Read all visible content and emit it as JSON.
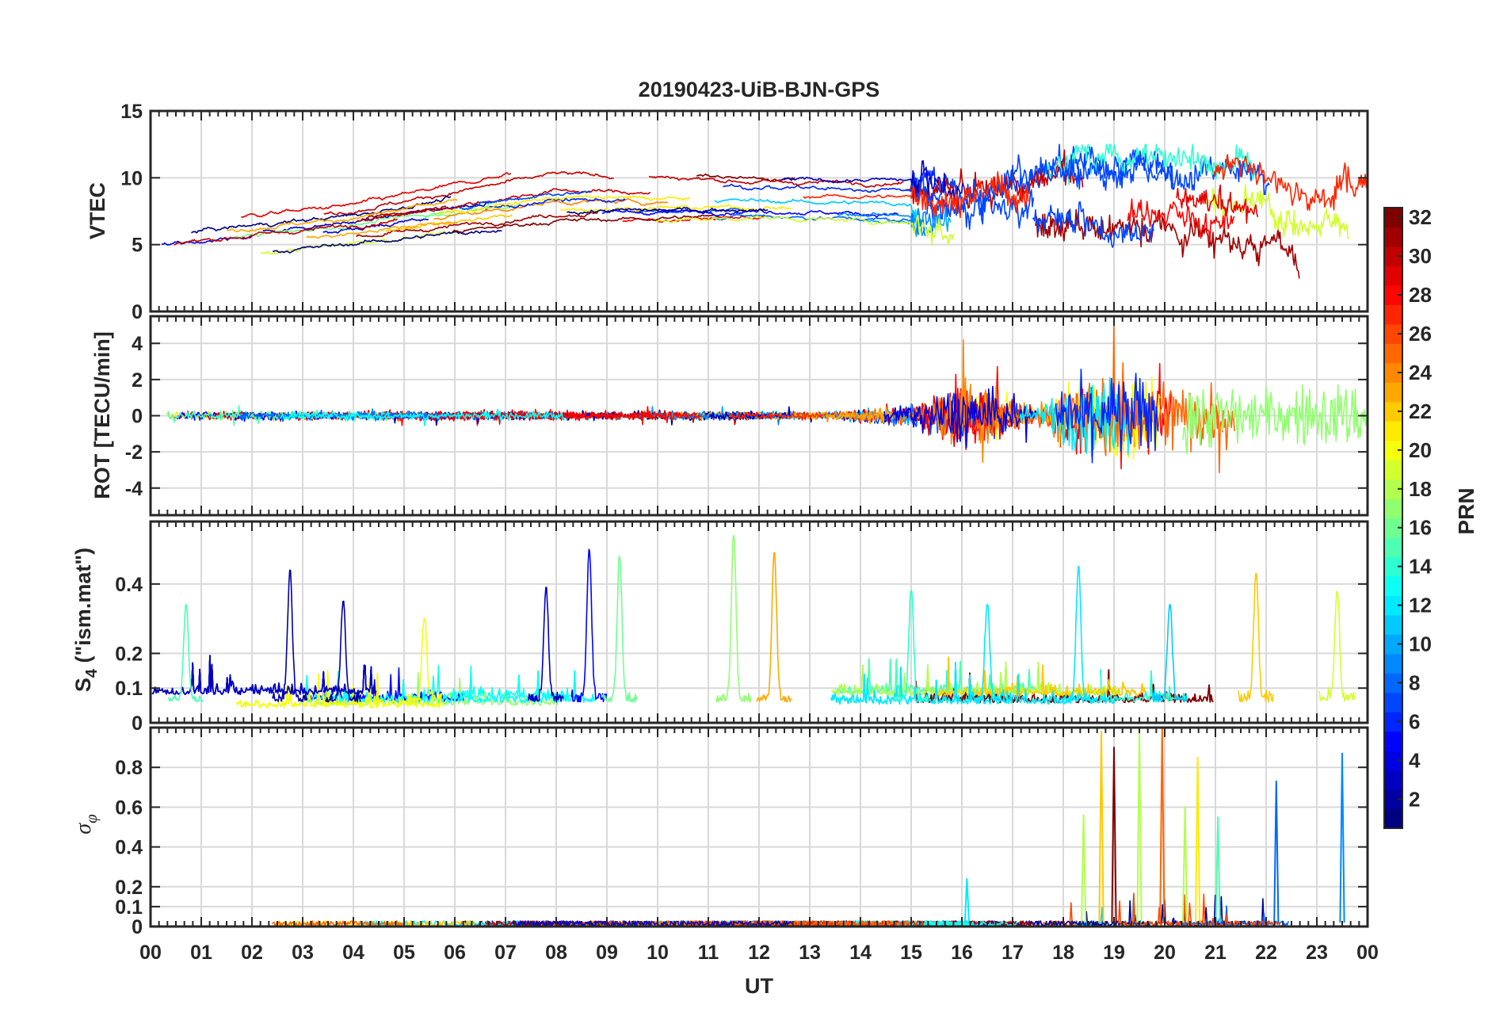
{
  "figure": {
    "title": "20190423-UiB-BJN-GPS"
  },
  "chart_data": {
    "type": "line",
    "title": "20190423-UiB-BJN-GPS",
    "shared_x": {
      "label": "UT",
      "range": [
        0,
        24
      ],
      "tick_labels": [
        "00",
        "01",
        "02",
        "03",
        "04",
        "05",
        "06",
        "07",
        "08",
        "09",
        "10",
        "11",
        "12",
        "13",
        "14",
        "15",
        "16",
        "17",
        "18",
        "19",
        "20",
        "21",
        "22",
        "23",
        "00"
      ],
      "grid": true
    },
    "color_scale": {
      "label": "PRN",
      "range": [
        1,
        32
      ],
      "colormap": "jet",
      "tick_labels": [
        "2",
        "4",
        "6",
        "8",
        "10",
        "12",
        "14",
        "16",
        "18",
        "20",
        "22",
        "24",
        "26",
        "28",
        "30",
        "32"
      ]
    },
    "note_series": "Each panel shows one line per GPS satellite (PRN 1-32), colored by PRN on the jet color scale; values are approximate envelope readings from the plot.",
    "panels": [
      {
        "key": "vtec",
        "ylabel": "VTEC",
        "ylim": [
          0,
          15
        ],
        "yticks": [
          0,
          5,
          10,
          15
        ],
        "ytick_labels": [
          "0",
          "5",
          "10",
          "15"
        ],
        "grid": true,
        "typical_range": {
          "x": [
            0,
            4,
            8,
            12,
            16,
            18,
            20,
            22,
            23,
            24
          ],
          "low": [
            3.5,
            5,
            6.5,
            7,
            6.5,
            6.5,
            6,
            5,
            3,
            5
          ],
          "high": [
            6.5,
            8,
            11,
            10,
            10,
            12,
            12.5,
            11.5,
            10,
            11
          ]
        },
        "peak_value": 12.5
      },
      {
        "key": "rot",
        "ylabel": "ROT [TECU/min]",
        "ylim": [
          -5.5,
          5.5
        ],
        "yticks": [
          -4,
          -2,
          0,
          2,
          4
        ],
        "ytick_labels": [
          "-4",
          "-2",
          "0",
          "2",
          "4"
        ],
        "grid": true,
        "typical_amplitude": {
          "x": [
            0,
            13.5,
            15,
            16,
            17.5,
            18,
            19,
            20,
            21,
            22,
            23,
            24
          ],
          "amp": [
            0.6,
            0.5,
            1.5,
            4.5,
            1.0,
            4.5,
            5.5,
            5.5,
            4.5,
            3.5,
            4.5,
            4.5
          ]
        }
      },
      {
        "key": "s4",
        "ylabel": "S4 (\"ism.mat\")",
        "ylabel_parts": {
          "main": "S",
          "sub": "4",
          "rest": " (\"ism.mat\")"
        },
        "ylim": [
          0,
          0.58
        ],
        "yticks": [
          0,
          0.1,
          0.2,
          0.4
        ],
        "ytick_labels": [
          "0",
          "0.1",
          "0.2",
          "0.4"
        ],
        "grid": true,
        "baseline_range": [
          0.04,
          0.12
        ],
        "peaks": [
          {
            "ut": 0.7,
            "s4": 0.34
          },
          {
            "ut": 2.75,
            "s4": 0.44
          },
          {
            "ut": 3.8,
            "s4": 0.35
          },
          {
            "ut": 5.4,
            "s4": 0.3
          },
          {
            "ut": 7.8,
            "s4": 0.39
          },
          {
            "ut": 8.65,
            "s4": 0.5
          },
          {
            "ut": 9.25,
            "s4": 0.48
          },
          {
            "ut": 11.5,
            "s4": 0.54
          },
          {
            "ut": 12.3,
            "s4": 0.49
          },
          {
            "ut": 15.0,
            "s4": 0.38
          },
          {
            "ut": 16.5,
            "s4": 0.34
          },
          {
            "ut": 18.3,
            "s4": 0.45
          },
          {
            "ut": 20.1,
            "s4": 0.34
          },
          {
            "ut": 21.8,
            "s4": 0.43
          },
          {
            "ut": 23.4,
            "s4": 0.38
          }
        ]
      },
      {
        "key": "sigma_phi",
        "ylabel": "σφ",
        "ylabel_parts": {
          "main": "σ",
          "sub": "φ"
        },
        "ylim": [
          0,
          1.0
        ],
        "yticks": [
          0,
          0.1,
          0.2,
          0.4,
          0.6,
          0.8
        ],
        "ytick_labels": [
          "0",
          "0.1",
          "0.2",
          "0.4",
          "0.6",
          "0.8"
        ],
        "grid": true,
        "baseline_range": [
          0.0,
          0.04
        ],
        "spikes": [
          {
            "ut": 16.1,
            "sigma": 0.24
          },
          {
            "ut": 18.4,
            "sigma": 0.56
          },
          {
            "ut": 18.75,
            "sigma": 0.98
          },
          {
            "ut": 19.0,
            "sigma": 0.9
          },
          {
            "ut": 19.5,
            "sigma": 1.0
          },
          {
            "ut": 19.95,
            "sigma": 1.0
          },
          {
            "ut": 20.4,
            "sigma": 0.6
          },
          {
            "ut": 20.65,
            "sigma": 0.85
          },
          {
            "ut": 21.05,
            "sigma": 0.55
          },
          {
            "ut": 22.2,
            "sigma": 0.73
          },
          {
            "ut": 23.5,
            "sigma": 0.87
          }
        ]
      }
    ]
  }
}
